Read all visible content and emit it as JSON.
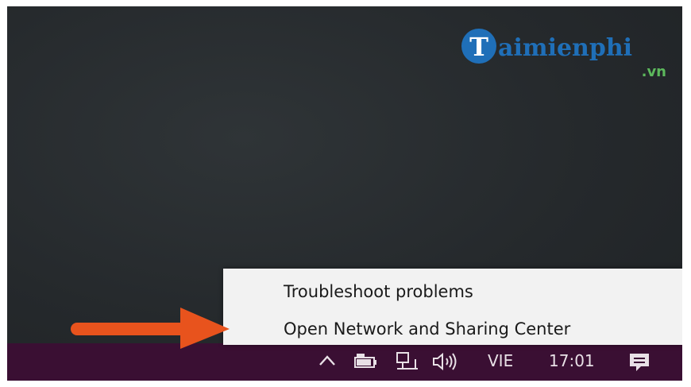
{
  "watermark": {
    "brand": "aimienphi",
    "tld": ".vn",
    "colors": {
      "brand_blue": "#1f6fb8",
      "tld_green": "#5cb85c"
    }
  },
  "context_menu": {
    "items": [
      {
        "label": "Troubleshoot problems"
      },
      {
        "label": "Open Network and Sharing Center"
      }
    ]
  },
  "annotation": {
    "icon": "arrow-right-icon",
    "color": "#e8531d"
  },
  "taskbar": {
    "background": "#3a0f33",
    "tray": {
      "icons": [
        "chevron-up-icon",
        "battery-icon",
        "network-icon",
        "volume-icon"
      ],
      "language": "VIE",
      "time": "17:01",
      "notification_icon": "action-center-icon"
    }
  }
}
